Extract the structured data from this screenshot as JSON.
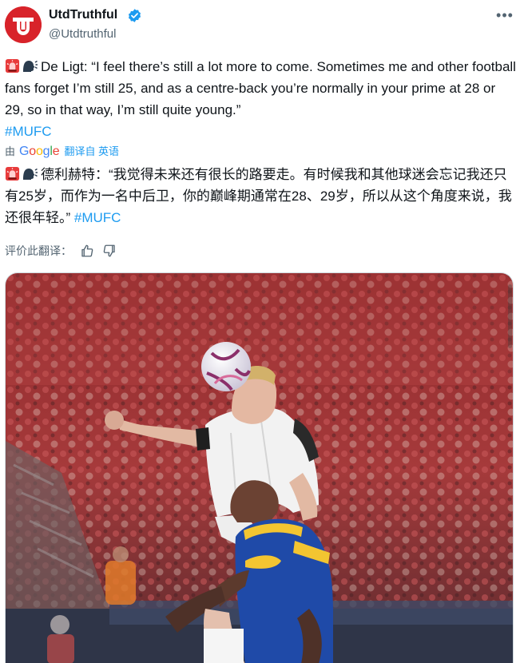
{
  "tweet": {
    "display_name": "UtdTruthful",
    "handle": "@Utdtruthful",
    "more_label": "•••",
    "original_text": "De Ligt: “I feel there’s still a lot more to come. Sometimes me and other football fans forget I’m still 25, and as a centre-back you’re normally in your prime at 28 or 29, so in that way, I’m still quite young.”",
    "original_hashtag": "#MUFC",
    "translated_text": "德利赫特：“我觉得未来还有很长的路要走。有时候我和其他球迷会忘记我还只有25岁，而作为一名中后卫，你的巅峰期通常在28、29岁，所以从这个角度来说，我还很年轻。”",
    "translated_hashtag": "#MUFC"
  },
  "translation": {
    "by_label": "由",
    "google_word": "Google",
    "translated_from": "翻译自 英语",
    "rate_label": "评价此翻译："
  },
  "icons": {
    "verified": "verified-badge-icon",
    "siren": "police-light-emoji",
    "speaking_head": "speaking-head-emoji",
    "thumbs_up": "thumbs-up-icon",
    "thumbs_down": "thumbs-down-icon",
    "more": "more-options-icon"
  },
  "colors": {
    "brand_red": "#d8232a",
    "link_blue": "#1d9bf0",
    "muted_text": "#536471",
    "home_kit": "#f2f2f2",
    "away_kit": "#1f4aa8"
  }
}
